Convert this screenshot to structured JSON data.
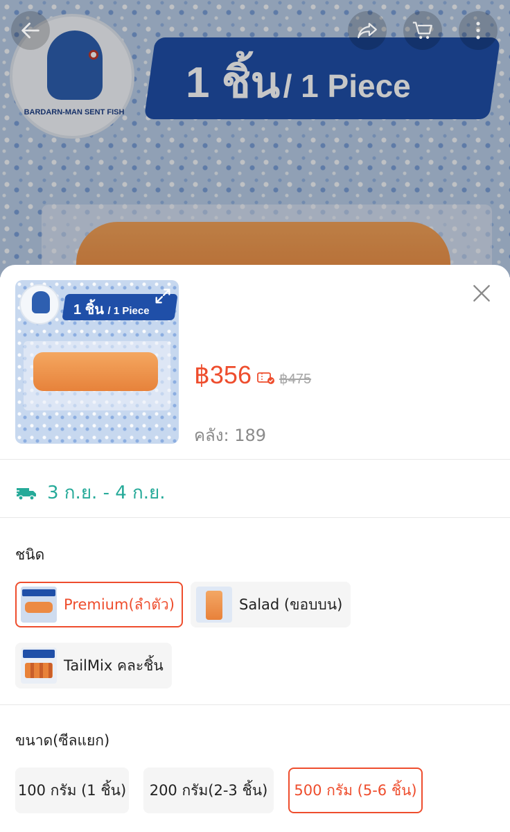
{
  "hero": {
    "logo_text": "BARDARN-MAN SENT FISH",
    "banner_big": "1 ชิ้น",
    "banner_small": "/ 1 Piece",
    "icons": [
      "back-arrow-icon",
      "share-icon",
      "cart-icon",
      "more-icon"
    ]
  },
  "product": {
    "thumb_banner_big": "1 ชิ้น",
    "thumb_banner_small": "/ 1 Piece",
    "price": "฿356",
    "original_price": "฿475",
    "stock_label": "คลัง: 189",
    "delivery_range": "3 ก.ย. - 4 ก.ย."
  },
  "variant_section": {
    "title": "ชนิด",
    "options": [
      {
        "label": "Premium(ลำตัว)",
        "selected": true
      },
      {
        "label": "Salad (ขอบบน)",
        "selected": false
      },
      {
        "label": "TailMix คละชิ้น",
        "selected": false
      }
    ]
  },
  "size_section": {
    "title": "ขนาด(ซีลแยก)",
    "options": [
      {
        "label": "100 กรัม (1 ชิ้น)",
        "selected": false
      },
      {
        "label": "200 กรัม(2-3 ชิ้น)",
        "selected": false
      },
      {
        "label": "500 กรัม (5-6 ชิ้น)",
        "selected": true
      }
    ]
  },
  "colors": {
    "accent": "#ee4d2d",
    "delivery": "#26aa99",
    "banner_blue": "#1f4fa8"
  }
}
